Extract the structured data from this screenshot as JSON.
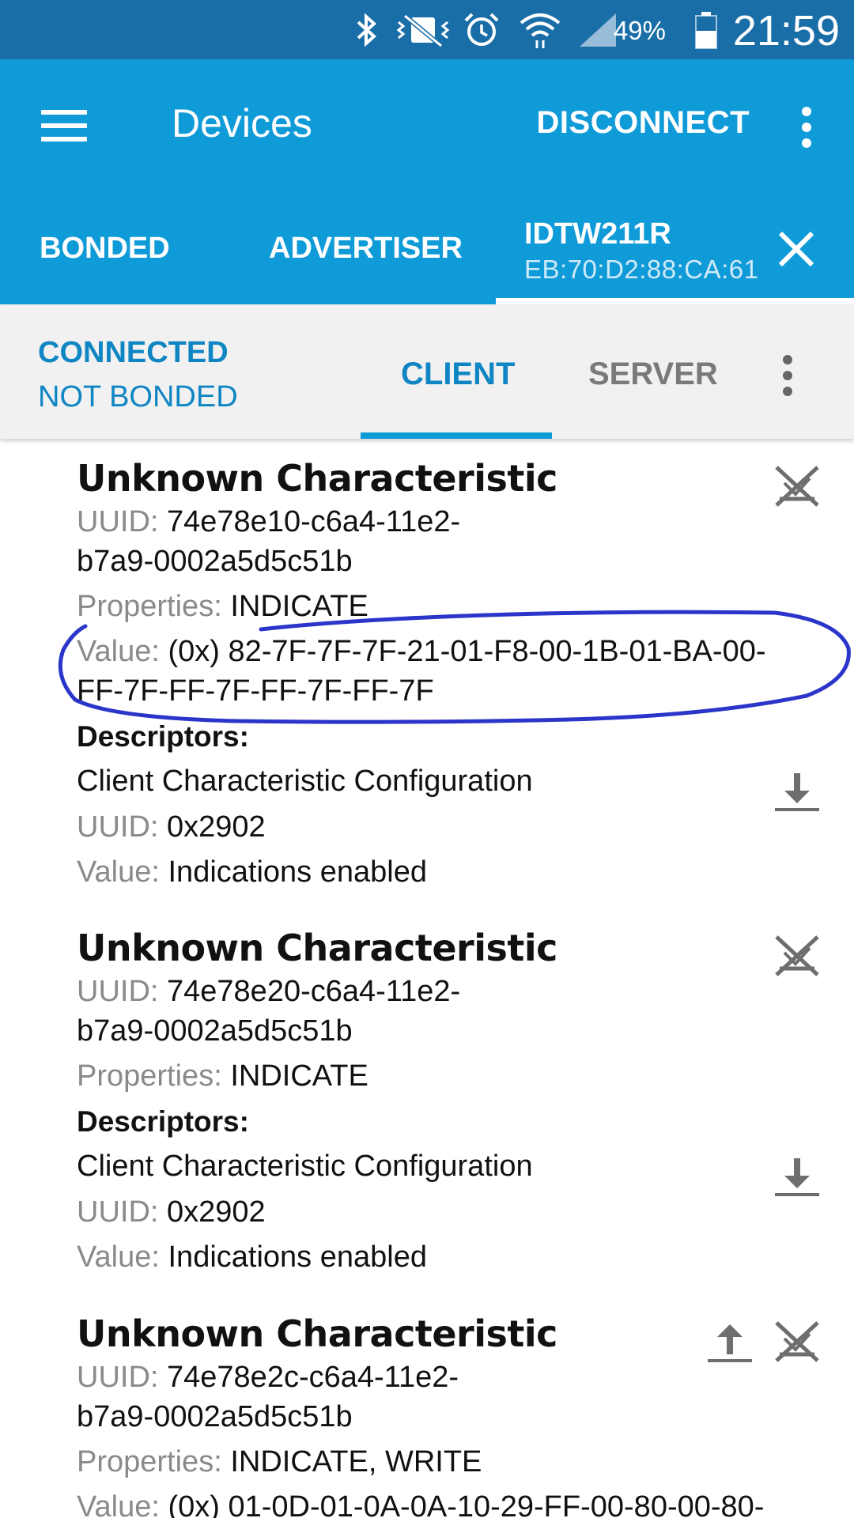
{
  "status_bar": {
    "icons": [
      "bluetooth-icon",
      "vibrate-mute-icon",
      "alarm-icon",
      "wifi-icon",
      "signal-icon",
      "battery-icon"
    ],
    "battery": "49%",
    "time": "21:59"
  },
  "app_bar": {
    "title": "Devices",
    "disconnect_label": "DISCONNECT",
    "tabs": [
      {
        "label": "BONDED"
      },
      {
        "label": "ADVERTISER"
      },
      {
        "label": "IDTW211R",
        "sublabel": "EB:70:D2:88:CA:61",
        "selected": true
      }
    ]
  },
  "connection": {
    "state": "CONNECTED",
    "bond_state": "NOT BONDED",
    "tabs": [
      {
        "label": "CLIENT",
        "selected": true
      },
      {
        "label": "SERVER"
      }
    ]
  },
  "labels": {
    "uuid": "UUID:",
    "properties": "Properties:",
    "value": "Value:",
    "descriptors": "Descriptors:"
  },
  "characteristics": [
    {
      "name": "Unknown Characteristic",
      "uuid_line1": "74e78e10-c6a4-11e2-",
      "uuid_line2": "b7a9-0002a5d5c51b",
      "properties": "INDICATE",
      "value_line1": "(0x) 82-7F-7F-7F-21-01-F8-00-1B-01-BA-00-",
      "value_line2": "FF-7F-FF-7F-FF-7F-FF-7F",
      "descriptor": {
        "name": "Client Characteristic Configuration",
        "uuid": "0x2902",
        "value": "Indications enabled"
      }
    },
    {
      "name": "Unknown Characteristic",
      "uuid_line1": "74e78e20-c6a4-11e2-",
      "uuid_line2": "b7a9-0002a5d5c51b",
      "properties": "INDICATE",
      "descriptor": {
        "name": "Client Characteristic Configuration",
        "uuid": "0x2902",
        "value": "Indications enabled"
      }
    },
    {
      "name": "Unknown Characteristic",
      "uuid_line1": "74e78e2c-c6a4-11e2-",
      "uuid_line2": "b7a9-0002a5d5c51b",
      "properties": "INDICATE, WRITE",
      "value_line1": "(0x) 01-0D-01-0A-0A-10-29-FF-00-80-00-80-"
    }
  ],
  "colors": {
    "status_bar": "#1a6ea8",
    "app_bar": "#0f9ad8",
    "accent": "#0f86c3",
    "annotation": "#2b35c9"
  }
}
